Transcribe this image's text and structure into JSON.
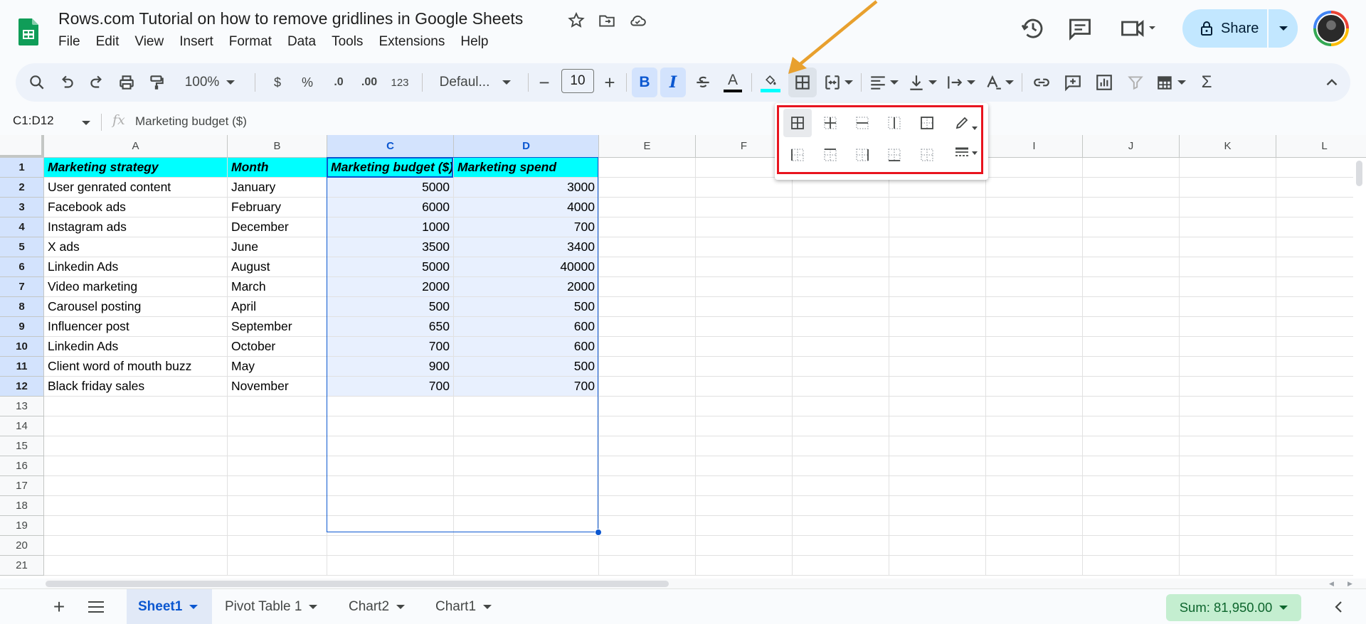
{
  "doc": {
    "title": "Rows.com Tutorial on how to remove gridlines in Google Sheets"
  },
  "menu": [
    "File",
    "Edit",
    "View",
    "Insert",
    "Format",
    "Data",
    "Tools",
    "Extensions",
    "Help"
  ],
  "header": {
    "share_label": "Share"
  },
  "toolbar": {
    "zoom": "100%",
    "currency": "$",
    "percent": "%",
    "decrease_decimal": ".0",
    "increase_decimal": ".00",
    "number_format": "123",
    "font": "Defaul...",
    "font_size": "10",
    "bold": "B",
    "italic": "I",
    "text_color_letter": "A",
    "fill_color": "#00ffff",
    "sigma": "Σ"
  },
  "formula_bar": {
    "name_box": "C1:D12",
    "fx": "fx",
    "value": "Marketing budget ($)"
  },
  "columns": [
    "A",
    "B",
    "C",
    "D",
    "E",
    "F",
    "G",
    "H",
    "I",
    "J",
    "K",
    "L"
  ],
  "rows": [
    "1",
    "2",
    "3",
    "4",
    "5",
    "6",
    "7",
    "8",
    "9",
    "10",
    "11",
    "12",
    "13",
    "14",
    "15",
    "16",
    "17",
    "18",
    "19",
    "20",
    "21"
  ],
  "sheet": {
    "header": [
      "Marketing strategy",
      "Month",
      "Marketing budget ($)",
      "Marketing spend"
    ],
    "data": [
      [
        "User genrated content",
        "January",
        "5000",
        "3000"
      ],
      [
        "Facebook ads",
        "February",
        "6000",
        "4000"
      ],
      [
        "Instagram ads",
        "December",
        "1000",
        "700"
      ],
      [
        "X ads",
        "June",
        "3500",
        "3400"
      ],
      [
        "Linkedin Ads",
        "August",
        "5000",
        "40000"
      ],
      [
        "Video marketing",
        "March",
        "2000",
        "2000"
      ],
      [
        "Carousel posting",
        "April",
        "500",
        "500"
      ],
      [
        "Influencer post",
        "September",
        "650",
        "600"
      ],
      [
        "Linkedin Ads",
        "October",
        "700",
        "600"
      ],
      [
        "Client word of mouth buzz",
        "May",
        "900",
        "500"
      ],
      [
        "Black friday sales",
        "November",
        "700",
        "700"
      ]
    ]
  },
  "borders_menu": {
    "options": [
      "all-borders",
      "inner-borders",
      "horizontal-borders",
      "vertical-borders",
      "outer-borders",
      "left-border",
      "top-border",
      "right-border",
      "bottom-border",
      "clear-borders"
    ],
    "tools": [
      "border-color",
      "border-style"
    ]
  },
  "bottom": {
    "tabs": [
      "Sheet1",
      "Pivot Table 1",
      "Chart2",
      "Chart1"
    ],
    "sum": "Sum: 81,950.00"
  },
  "colors": {
    "accent": "#0b57d0",
    "header_fill": "#00ffff",
    "annotation": "#e8141e",
    "arrow": "#e8a02e"
  }
}
